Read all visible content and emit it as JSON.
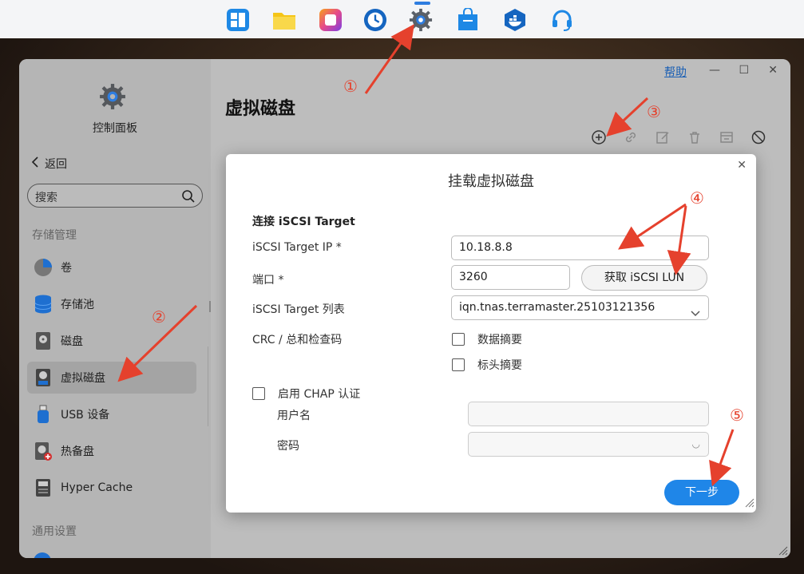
{
  "taskbar": {
    "apps": [
      {
        "name": "dashboard",
        "color": "#1e88e5"
      },
      {
        "name": "file-manager",
        "color": "#f5c518"
      },
      {
        "name": "app-center",
        "color": "#e64a8a"
      },
      {
        "name": "backup",
        "color": "#1565c0"
      },
      {
        "name": "control-panel",
        "color": "#555a60"
      },
      {
        "name": "store",
        "color": "#1e88e5"
      },
      {
        "name": "docker",
        "color": "#1565c0"
      },
      {
        "name": "support",
        "color": "#1e88e5"
      }
    ]
  },
  "window": {
    "help": "帮助",
    "controls": {
      "minimize": "—",
      "maximize": "☐",
      "close": "✕"
    }
  },
  "sidebar": {
    "app_title": "控制面板",
    "back": "返回",
    "search_placeholder": "搜索",
    "section_storage": "存储管理",
    "items": [
      {
        "label": "卷",
        "icon": "pie-icon"
      },
      {
        "label": "存储池",
        "icon": "database-icon"
      },
      {
        "label": "磁盘",
        "icon": "disk-icon"
      },
      {
        "label": "虚拟磁盘",
        "icon": "virtual-disk-icon"
      },
      {
        "label": "USB 设备",
        "icon": "usb-icon"
      },
      {
        "label": "热备盘",
        "icon": "hotspare-icon"
      },
      {
        "label": "Hyper Cache",
        "icon": "ssd-icon"
      }
    ],
    "section_general": "通用设置"
  },
  "main": {
    "title": "虚拟磁盘",
    "toolbar": [
      "add-icon",
      "link-icon",
      "edit-icon",
      "delete-icon",
      "eject-icon",
      "disable-icon"
    ]
  },
  "dialog": {
    "title": "挂载虚拟磁盘",
    "section": "连接 iSCSI Target",
    "ip_label": "iSCSI Target IP *",
    "ip_value": "10.18.8.8",
    "port_label": "端口 *",
    "port_value": "3260",
    "fetch_button": "获取 iSCSI LUN",
    "list_label": "iSCSI Target 列表",
    "list_value": "iqn.tnas.terramaster.25103121356",
    "crc_label": "CRC / 总和检查码",
    "data_digest": "数据摘要",
    "header_digest": "标头摘要",
    "chap_label": "启用 CHAP 认证",
    "username_label": "用户名",
    "password_label": "密码",
    "next_button": "下一步"
  },
  "annotations": [
    "①",
    "②",
    "③",
    "④",
    "⑤"
  ],
  "colors": {
    "accent": "#1f86e8",
    "annotation": "#e5412d"
  }
}
